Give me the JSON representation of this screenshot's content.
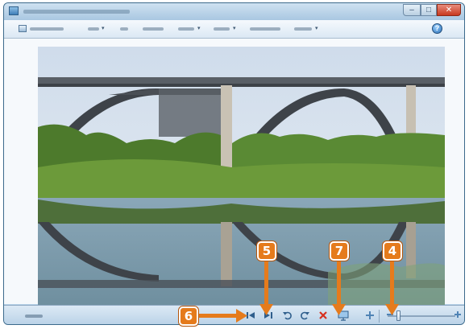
{
  "window": {
    "title": ""
  },
  "menu": {
    "items": [
      {
        "name": "menu-go-to-gallery",
        "label": ""
      },
      {
        "name": "menu-fix",
        "label": ""
      },
      {
        "name": "menu-info",
        "label": ""
      },
      {
        "name": "menu-email",
        "label": ""
      },
      {
        "name": "menu-print",
        "label": ""
      },
      {
        "name": "menu-make",
        "label": ""
      },
      {
        "name": "menu-slideshow",
        "label": ""
      },
      {
        "name": "menu-share",
        "label": ""
      }
    ]
  },
  "photo": {
    "description_icon": "photo-of-bridge-over-river"
  },
  "status": {
    "position": ""
  },
  "controls": {
    "icons": [
      "previous-icon",
      "next-icon",
      "rotate-left-icon",
      "rotate-right-icon",
      "delete-icon",
      "slideshow-icon",
      "actual-size-icon"
    ]
  },
  "callouts": {
    "c4": "4",
    "c5": "5",
    "c6": "6",
    "c7": "7"
  },
  "colors": {
    "callout": "#e57b1c",
    "frame": "#b7d2e8",
    "close_button": "#c8391f"
  }
}
